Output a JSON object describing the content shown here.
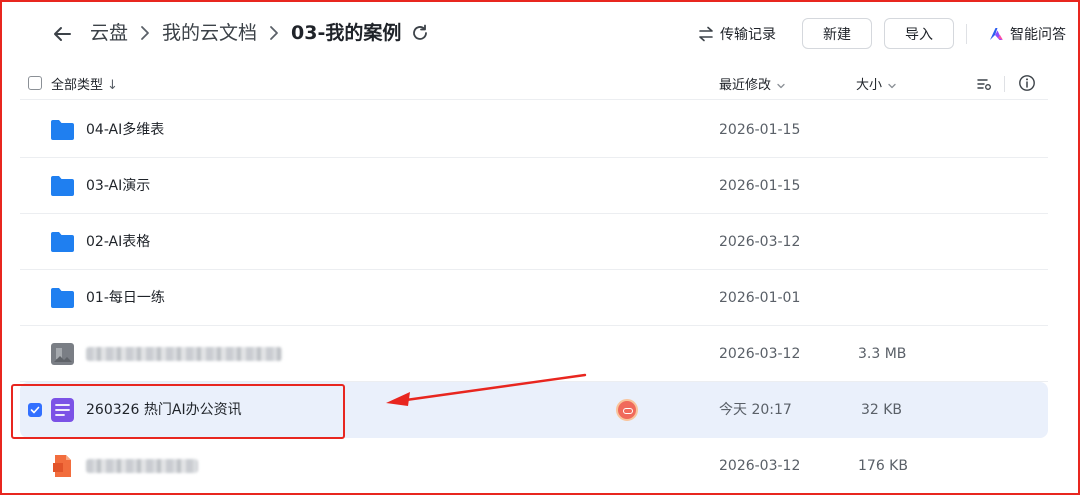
{
  "breadcrumb": {
    "items": [
      "云盘",
      "我的云文档"
    ],
    "current": "03-我的案例"
  },
  "toolbar": {
    "transfer_label": "传输记录",
    "new_label": "新建",
    "import_label": "导入",
    "ai_label": "智能问答"
  },
  "columns": {
    "type_label": "全部类型",
    "type_sort_arrow": "↓",
    "modified_label": "最近修改",
    "size_label": "大小"
  },
  "files": [
    {
      "name": "04-AI多维表",
      "modified": "2026-01-15",
      "size": "",
      "kind": "folder"
    },
    {
      "name": "03-AI演示",
      "modified": "2026-01-15",
      "size": "",
      "kind": "folder"
    },
    {
      "name": "02-AI表格",
      "modified": "2026-03-12",
      "size": "",
      "kind": "folder"
    },
    {
      "name": "01-每日一练",
      "modified": "2026-01-01",
      "size": "",
      "kind": "folder"
    },
    {
      "name": "",
      "modified": "2026-03-12",
      "size": "3.3 MB",
      "kind": "image-blurred"
    },
    {
      "name": "260326 热门AI办公资讯",
      "modified": "今天 20:17",
      "size": "32 KB",
      "kind": "doc",
      "selected": true
    },
    {
      "name": "",
      "modified": "2026-03-12",
      "size": "176 KB",
      "kind": "ppt-blurred"
    }
  ],
  "colors": {
    "folder": "#1f7ff0",
    "doc": "#7b52e6",
    "accent": "#3370ff",
    "annotation": "#e8261f",
    "selected_row": "#eaf0fb"
  },
  "icons": [
    "back-arrow-icon",
    "chevron-right-icon",
    "refresh-icon",
    "transfer-icon",
    "ai-logo-icon",
    "chevron-down-icon",
    "column-settings-icon",
    "info-icon",
    "folder-icon",
    "image-file-icon",
    "doc-file-icon",
    "ppt-file-icon",
    "collaborator-avatar"
  ]
}
